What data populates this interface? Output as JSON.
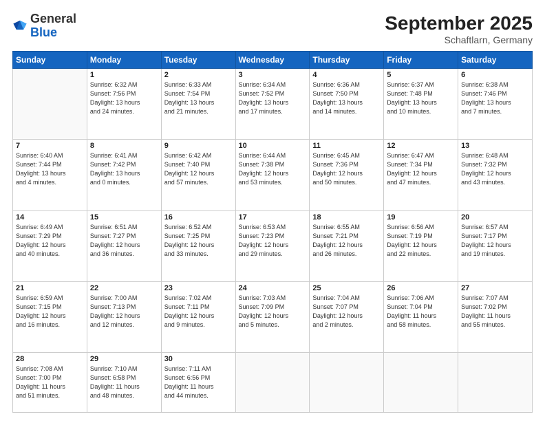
{
  "header": {
    "logo": {
      "general": "General",
      "blue": "Blue"
    },
    "title": "September 2025",
    "subtitle": "Schaftlarn, Germany"
  },
  "weekdays": [
    "Sunday",
    "Monday",
    "Tuesday",
    "Wednesday",
    "Thursday",
    "Friday",
    "Saturday"
  ],
  "weeks": [
    [
      {
        "day": "",
        "info": ""
      },
      {
        "day": "1",
        "info": "Sunrise: 6:32 AM\nSunset: 7:56 PM\nDaylight: 13 hours\nand 24 minutes."
      },
      {
        "day": "2",
        "info": "Sunrise: 6:33 AM\nSunset: 7:54 PM\nDaylight: 13 hours\nand 21 minutes."
      },
      {
        "day": "3",
        "info": "Sunrise: 6:34 AM\nSunset: 7:52 PM\nDaylight: 13 hours\nand 17 minutes."
      },
      {
        "day": "4",
        "info": "Sunrise: 6:36 AM\nSunset: 7:50 PM\nDaylight: 13 hours\nand 14 minutes."
      },
      {
        "day": "5",
        "info": "Sunrise: 6:37 AM\nSunset: 7:48 PM\nDaylight: 13 hours\nand 10 minutes."
      },
      {
        "day": "6",
        "info": "Sunrise: 6:38 AM\nSunset: 7:46 PM\nDaylight: 13 hours\nand 7 minutes."
      }
    ],
    [
      {
        "day": "7",
        "info": "Sunrise: 6:40 AM\nSunset: 7:44 PM\nDaylight: 13 hours\nand 4 minutes."
      },
      {
        "day": "8",
        "info": "Sunrise: 6:41 AM\nSunset: 7:42 PM\nDaylight: 13 hours\nand 0 minutes."
      },
      {
        "day": "9",
        "info": "Sunrise: 6:42 AM\nSunset: 7:40 PM\nDaylight: 12 hours\nand 57 minutes."
      },
      {
        "day": "10",
        "info": "Sunrise: 6:44 AM\nSunset: 7:38 PM\nDaylight: 12 hours\nand 53 minutes."
      },
      {
        "day": "11",
        "info": "Sunrise: 6:45 AM\nSunset: 7:36 PM\nDaylight: 12 hours\nand 50 minutes."
      },
      {
        "day": "12",
        "info": "Sunrise: 6:47 AM\nSunset: 7:34 PM\nDaylight: 12 hours\nand 47 minutes."
      },
      {
        "day": "13",
        "info": "Sunrise: 6:48 AM\nSunset: 7:32 PM\nDaylight: 12 hours\nand 43 minutes."
      }
    ],
    [
      {
        "day": "14",
        "info": "Sunrise: 6:49 AM\nSunset: 7:29 PM\nDaylight: 12 hours\nand 40 minutes."
      },
      {
        "day": "15",
        "info": "Sunrise: 6:51 AM\nSunset: 7:27 PM\nDaylight: 12 hours\nand 36 minutes."
      },
      {
        "day": "16",
        "info": "Sunrise: 6:52 AM\nSunset: 7:25 PM\nDaylight: 12 hours\nand 33 minutes."
      },
      {
        "day": "17",
        "info": "Sunrise: 6:53 AM\nSunset: 7:23 PM\nDaylight: 12 hours\nand 29 minutes."
      },
      {
        "day": "18",
        "info": "Sunrise: 6:55 AM\nSunset: 7:21 PM\nDaylight: 12 hours\nand 26 minutes."
      },
      {
        "day": "19",
        "info": "Sunrise: 6:56 AM\nSunset: 7:19 PM\nDaylight: 12 hours\nand 22 minutes."
      },
      {
        "day": "20",
        "info": "Sunrise: 6:57 AM\nSunset: 7:17 PM\nDaylight: 12 hours\nand 19 minutes."
      }
    ],
    [
      {
        "day": "21",
        "info": "Sunrise: 6:59 AM\nSunset: 7:15 PM\nDaylight: 12 hours\nand 16 minutes."
      },
      {
        "day": "22",
        "info": "Sunrise: 7:00 AM\nSunset: 7:13 PM\nDaylight: 12 hours\nand 12 minutes."
      },
      {
        "day": "23",
        "info": "Sunrise: 7:02 AM\nSunset: 7:11 PM\nDaylight: 12 hours\nand 9 minutes."
      },
      {
        "day": "24",
        "info": "Sunrise: 7:03 AM\nSunset: 7:09 PM\nDaylight: 12 hours\nand 5 minutes."
      },
      {
        "day": "25",
        "info": "Sunrise: 7:04 AM\nSunset: 7:07 PM\nDaylight: 12 hours\nand 2 minutes."
      },
      {
        "day": "26",
        "info": "Sunrise: 7:06 AM\nSunset: 7:04 PM\nDaylight: 11 hours\nand 58 minutes."
      },
      {
        "day": "27",
        "info": "Sunrise: 7:07 AM\nSunset: 7:02 PM\nDaylight: 11 hours\nand 55 minutes."
      }
    ],
    [
      {
        "day": "28",
        "info": "Sunrise: 7:08 AM\nSunset: 7:00 PM\nDaylight: 11 hours\nand 51 minutes."
      },
      {
        "day": "29",
        "info": "Sunrise: 7:10 AM\nSunset: 6:58 PM\nDaylight: 11 hours\nand 48 minutes."
      },
      {
        "day": "30",
        "info": "Sunrise: 7:11 AM\nSunset: 6:56 PM\nDaylight: 11 hours\nand 44 minutes."
      },
      {
        "day": "",
        "info": ""
      },
      {
        "day": "",
        "info": ""
      },
      {
        "day": "",
        "info": ""
      },
      {
        "day": "",
        "info": ""
      }
    ]
  ]
}
